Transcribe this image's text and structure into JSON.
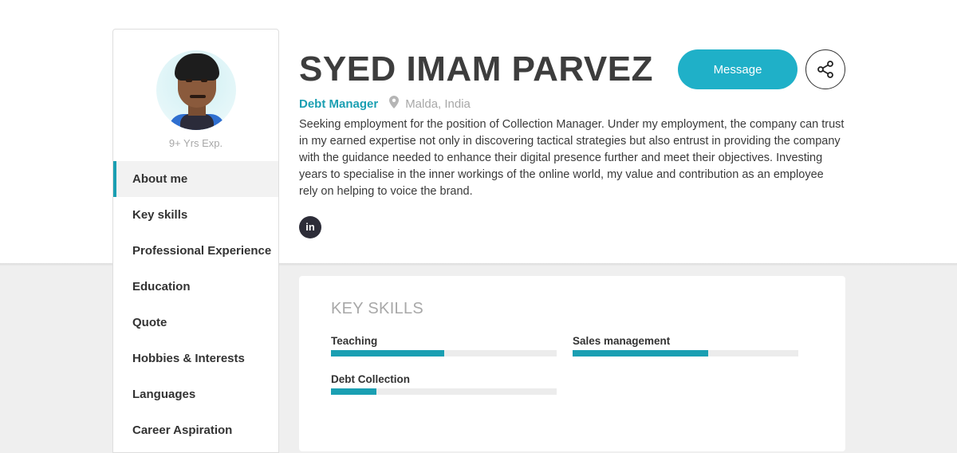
{
  "profile": {
    "name": "SYED IMAM PARVEZ",
    "job_title": "Debt Manager",
    "location": "Malda, India",
    "experience": "9+ Yrs Exp.",
    "about": "Seeking employment for the position of Collection Manager. Under my employment, the company can trust in my earned expertise not only in discovering tactical strategies but also entrust in providing the company with the guidance needed to enhance their digital presence further and meet their objectives. Investing years to specialise in the inner workings of the online world, my value and contribution as an employee rely on helping to voice the brand.",
    "social_icon_text": "in"
  },
  "actions": {
    "message_label": "Message",
    "share_icon": "share-icon"
  },
  "sidebar": {
    "items": [
      {
        "label": "About me"
      },
      {
        "label": "Key skills"
      },
      {
        "label": "Professional Experience"
      },
      {
        "label": "Education"
      },
      {
        "label": "Quote"
      },
      {
        "label": "Hobbies & Interests"
      },
      {
        "label": "Languages"
      },
      {
        "label": "Career Aspiration"
      }
    ],
    "active_index": 0
  },
  "key_skills": {
    "title": "KEY SKILLS",
    "skills": [
      {
        "name": "Teaching",
        "level": 0.5
      },
      {
        "name": "Sales management",
        "level": 0.6
      },
      {
        "name": "Debt Collection",
        "level": 0.2
      }
    ]
  },
  "colors": {
    "accent": "#1a9fb2",
    "button": "#1fb0c8",
    "muted": "#a8a8a8"
  }
}
